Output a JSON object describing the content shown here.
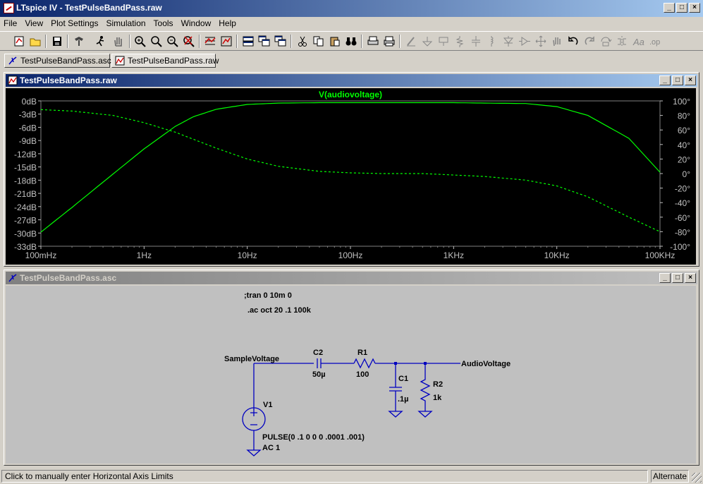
{
  "window": {
    "title": "LTspice IV - TestPulseBandPass.raw"
  },
  "menu": [
    "File",
    "View",
    "Plot Settings",
    "Simulation",
    "Tools",
    "Window",
    "Help"
  ],
  "toolbar_icons": [
    "new-schematic",
    "open",
    "save",
    "control-panel",
    "run",
    "halt",
    "zoom-in",
    "pan",
    "zoom-out",
    "zoom-fit",
    "autorange",
    "drag",
    "tile-horizontal",
    "cascade",
    "tile-vertical",
    "cut",
    "copy",
    "paste",
    "find",
    "print-preview",
    "print",
    "wire",
    "ground",
    "label-net",
    "resistor",
    "capacitor",
    "inductor",
    "diode",
    "component",
    "move",
    "drag-hand",
    "undo",
    "redo",
    "rotate",
    "mirror",
    "text",
    "spice-directive"
  ],
  "tabs": [
    {
      "label": "TestPulseBandPass.asc",
      "icon": "schematic-icon"
    },
    {
      "label": "TestPulseBandPass.raw",
      "icon": "waveform-icon"
    }
  ],
  "plot_window": {
    "title": "TestPulseBandPass.raw",
    "trace": "V(audiovoltage)"
  },
  "schematic_window": {
    "title": "TestPulseBandPass.asc"
  },
  "chart_data": {
    "type": "line",
    "title": "V(audiovoltage)",
    "x_scale": "log",
    "x_ticks": [
      "100mHz",
      "1Hz",
      "10Hz",
      "100Hz",
      "1KHz",
      "10KHz",
      "100KHz"
    ],
    "x_range": [
      0.1,
      100000
    ],
    "y_left_ticks": [
      "0dB",
      "-3dB",
      "-6dB",
      "-9dB",
      "-12dB",
      "-15dB",
      "-18dB",
      "-21dB",
      "-24dB",
      "-27dB",
      "-30dB",
      "-33dB"
    ],
    "y_left_range": [
      -33,
      0
    ],
    "y_right_ticks": [
      "100°",
      "80°",
      "60°",
      "40°",
      "20°",
      "0°",
      "-20°",
      "-40°",
      "-60°",
      "-80°",
      "-100°"
    ],
    "y_right_range": [
      -100,
      100
    ],
    "series": [
      {
        "style": "solid",
        "color": "#00ff00",
        "axis": "left",
        "x": [
          0.1,
          0.2,
          0.5,
          1,
          2,
          3,
          5,
          10,
          20,
          50,
          100,
          200,
          500,
          1000,
          2000,
          5000,
          10000,
          20000,
          50000,
          100000
        ],
        "values": [
          -29.8,
          -24.2,
          -16.6,
          -10.9,
          -5.8,
          -3.6,
          -1.9,
          -0.8,
          -0.5,
          -0.4,
          -0.4,
          -0.4,
          -0.4,
          -0.4,
          -0.5,
          -0.6,
          -1.3,
          -3.3,
          -8.5,
          -16.2
        ]
      },
      {
        "style": "dashed",
        "color": "#00ff00",
        "axis": "right",
        "x": [
          0.1,
          0.2,
          0.5,
          1,
          2,
          5,
          10,
          20,
          50,
          100,
          200,
          500,
          1000,
          2000,
          5000,
          10000,
          20000,
          50000,
          100000
        ],
        "values": [
          88,
          86,
          80,
          70,
          57,
          35,
          20,
          10,
          3,
          1,
          0,
          0,
          -2,
          -4,
          -9,
          -17,
          -32,
          -60,
          -80
        ]
      }
    ]
  },
  "schematic": {
    "directives": [
      ";tran 0 10m 0",
      ".ac oct 20 .1 100k"
    ],
    "nets": [
      "SampleVoltage",
      "AudioVoltage"
    ],
    "components": [
      {
        "ref": "C2",
        "value": "50µ"
      },
      {
        "ref": "R1",
        "value": "100"
      },
      {
        "ref": "C1",
        "value": ".1µ"
      },
      {
        "ref": "R2",
        "value": "1k"
      },
      {
        "ref": "V1",
        "value": "PULSE(0 .1 0 0 0 .0001 .001)",
        "ac": "AC 1"
      }
    ]
  },
  "status": {
    "message": "Click to manually enter Horizontal Axis Limits",
    "mode": "Alternate"
  }
}
